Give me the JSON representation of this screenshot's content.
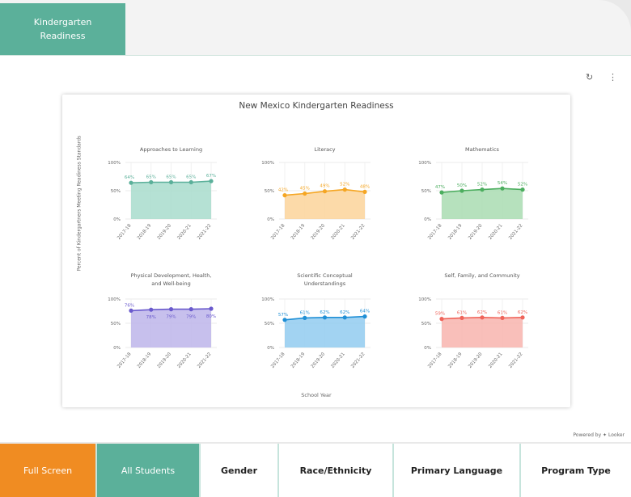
{
  "header": {
    "active_tab_line1": "Kindergarten",
    "active_tab_line2": "Readiness"
  },
  "controls": {
    "refresh_icon": "refresh-icon",
    "more_icon": "more-vertical-icon"
  },
  "dashboard": {
    "title": "New Mexico Kindergarten Readiness",
    "y_axis_title": "Percent of Kindergartners Meeting Readiness Standards",
    "x_axis_title": "School Year",
    "powered_by": "Powered by ✦ Looker"
  },
  "chart_data": [
    {
      "type": "area",
      "title": "Approaches to Learning",
      "x": [
        "2017-18",
        "2018-19",
        "2019-20",
        "2020-21",
        "2021-22"
      ],
      "values": [
        64,
        65,
        65,
        65,
        67
      ],
      "labels": [
        "64%",
        "65%",
        "65%",
        "65%",
        "67%"
      ],
      "ylim": [
        0,
        100
      ],
      "yticks": [
        "100%",
        "50%",
        "0%"
      ],
      "color": "#5bb09a",
      "fill": "#a8dccd"
    },
    {
      "type": "area",
      "title": "Literacy",
      "x": [
        "2017-18",
        "2018-19",
        "2019-20",
        "2020-21",
        "2021-22"
      ],
      "values": [
        42,
        45,
        49,
        52,
        48
      ],
      "labels": [
        "42%",
        "45%",
        "49%",
        "52%",
        "48%"
      ],
      "ylim": [
        0,
        100
      ],
      "yticks": [
        "100%",
        "50%",
        "0%"
      ],
      "color": "#f5a623",
      "fill": "#fbd49a"
    },
    {
      "type": "area",
      "title": "Mathematics",
      "x": [
        "2017-18",
        "2018-19",
        "2019-20",
        "2020-21",
        "2021-22"
      ],
      "values": [
        47,
        50,
        52,
        54,
        52
      ],
      "labels": [
        "47%",
        "50%",
        "52%",
        "54%",
        "52%"
      ],
      "ylim": [
        0,
        100
      ],
      "yticks": [
        "100%",
        "50%",
        "0%"
      ],
      "color": "#4cae5f",
      "fill": "#a9dcb2"
    },
    {
      "type": "area",
      "title": "Physical Development, Health, and Well-being",
      "x": [
        "2017-18",
        "2018-19",
        "2019-20",
        "2020-21",
        "2021-22"
      ],
      "values": [
        76,
        78,
        79,
        79,
        80
      ],
      "labels": [
        "76%",
        "78%",
        "79%",
        "79%",
        "80%"
      ],
      "ylim": [
        0,
        100
      ],
      "yticks": [
        "100%",
        "50%",
        "0%"
      ],
      "color": "#6a5acd",
      "fill": "#bdb5ea"
    },
    {
      "type": "area",
      "title": "Scientific Conceptual Understandings",
      "x": [
        "2017-18",
        "2018-19",
        "2019-20",
        "2020-21",
        "2021-22"
      ],
      "values": [
        57,
        61,
        62,
        62,
        64
      ],
      "labels": [
        "57%",
        "61%",
        "62%",
        "62%",
        "64%"
      ],
      "ylim": [
        0,
        100
      ],
      "yticks": [
        "100%",
        "50%",
        "0%"
      ],
      "color": "#1f8fd6",
      "fill": "#92cbf0"
    },
    {
      "type": "area",
      "title": "Self, Family, and Community",
      "x": [
        "2017-18",
        "2018-19",
        "2019-20",
        "2020-21",
        "2021-22"
      ],
      "values": [
        59,
        61,
        62,
        61,
        62
      ],
      "labels": [
        "59%",
        "61%",
        "62%",
        "61%",
        "62%"
      ],
      "ylim": [
        0,
        100
      ],
      "yticks": [
        "100%",
        "50%",
        "0%"
      ],
      "color": "#f0645a",
      "fill": "#f8b4ae"
    }
  ],
  "bottom_tabs": {
    "full_screen": "Full Screen",
    "all_students": "All Students",
    "gender": "Gender",
    "race": "Race/Ethnicity",
    "language": "Primary Language",
    "program": "Program Type"
  }
}
